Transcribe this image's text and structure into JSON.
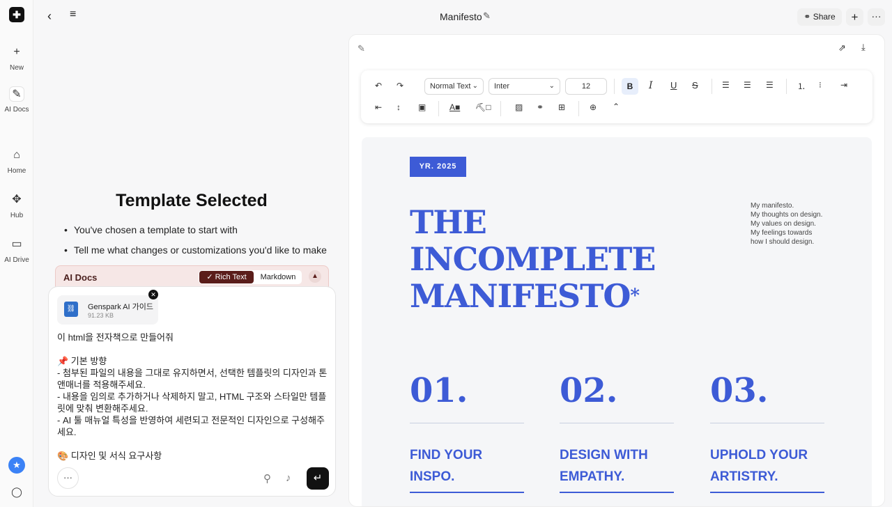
{
  "rail": {
    "items": [
      {
        "label": "New",
        "icon": "plus-icon"
      },
      {
        "label": "AI Docs",
        "icon": "ai-docs-icon"
      },
      {
        "label": "Home",
        "icon": "home-icon"
      },
      {
        "label": "Hub",
        "icon": "hub-icon"
      },
      {
        "label": "AI Drive",
        "icon": "drive-icon"
      }
    ]
  },
  "topbar": {
    "title": "Manifesto",
    "share_label": "Share"
  },
  "chat": {
    "heading": "Template Selected",
    "bullets": [
      "You've chosen a template to start with",
      "Tell me what changes or customizations you'd like to make"
    ],
    "mode_bar": {
      "label": "AI Docs",
      "rich_text": "Rich Text",
      "markdown": "Markdown"
    },
    "attachment": {
      "name": "Genspark AI 가이드.html",
      "size": "91.23 KB"
    },
    "message": "이 html을 전자책으로 만들어줘\n\n📌 기본 방향\n- 첨부된 파일의 내용을 그대로 유지하면서, 선택한 템플릿의 디자인과 톤앤매너를 적용해주세요.\n- 내용을 임의로 추가하거나 삭제하지 말고, HTML 구조와 스타일만 템플릿에 맞춰 변환해주세요.\n- AI 툴 매뉴얼 특성을 반영하여 세련되고 전문적인 디자인으로 구성해주세요.\n\n🎨 디자인 및 서식 요구사항"
  },
  "toolbar": {
    "text_style": "Normal Text",
    "font": "Inter",
    "font_size": "12"
  },
  "document": {
    "year_badge": "YR. 2025",
    "title_lines": [
      "THE",
      "INCOMPLETE",
      "MANIFESTO"
    ],
    "title_mark": "*",
    "aside_lines": [
      "My manifesto.",
      "My thoughts on design.",
      "My values on design.",
      "My feelings towards",
      "how I should design."
    ],
    "columns": [
      {
        "num": "01.",
        "head_lines": [
          "FIND YOUR",
          "INSPO."
        ]
      },
      {
        "num": "02.",
        "head_lines": [
          "DESIGN WITH",
          "EMPATHY."
        ]
      },
      {
        "num": "03.",
        "head_lines": [
          "UPHOLD YOUR",
          "ARTISTRY."
        ]
      }
    ],
    "accent_color": "#3d5bd6"
  }
}
